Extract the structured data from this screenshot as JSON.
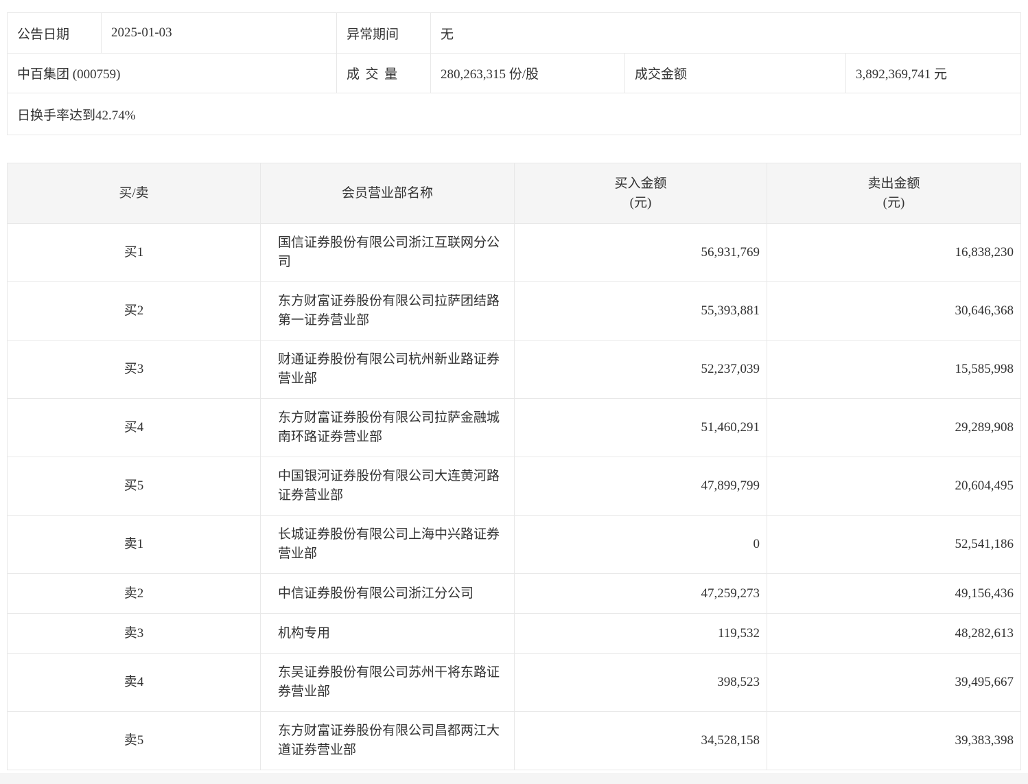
{
  "colors": {
    "header_bg": "#f5f5f5",
    "border": "#e8e8e8",
    "text": "#333333"
  },
  "info": {
    "announce_date_label": "公告日期",
    "announce_date": "2025-01-03",
    "abnormal_period_label": "异常期间",
    "abnormal_period": "无",
    "stock_name": "中百集团 (000759)",
    "volume_label": "成交量",
    "volume_value": "280,263,315 份/股",
    "amount_label": "成交金额",
    "amount_value": "3,892,369,741 元",
    "turnover_note": "日换手率达到42.74%"
  },
  "table": {
    "headers": {
      "side": "买/卖",
      "branch": "会员营业部名称",
      "buy_amount": "买入金额",
      "sell_amount": "卖出金额",
      "unit": "(元)"
    },
    "rows": [
      {
        "label": "买1",
        "name": "国信证券股份有限公司浙江互联网分公司",
        "buy": "56,931,769",
        "sell": "16,838,230"
      },
      {
        "label": "买2",
        "name": "东方财富证券股份有限公司拉萨团结路第一证券营业部",
        "buy": "55,393,881",
        "sell": "30,646,368"
      },
      {
        "label": "买3",
        "name": "财通证券股份有限公司杭州新业路证券营业部",
        "buy": "52,237,039",
        "sell": "15,585,998"
      },
      {
        "label": "买4",
        "name": "东方财富证券股份有限公司拉萨金融城南环路证券营业部",
        "buy": "51,460,291",
        "sell": "29,289,908"
      },
      {
        "label": "买5",
        "name": "中国银河证券股份有限公司大连黄河路证券营业部",
        "buy": "47,899,799",
        "sell": "20,604,495"
      },
      {
        "label": "卖1",
        "name": "长城证券股份有限公司上海中兴路证券营业部",
        "buy": "0",
        "sell": "52,541,186"
      },
      {
        "label": "卖2",
        "name": "中信证券股份有限公司浙江分公司",
        "buy": "47,259,273",
        "sell": "49,156,436"
      },
      {
        "label": "卖3",
        "name": "机构专用",
        "buy": "119,532",
        "sell": "48,282,613"
      },
      {
        "label": "卖4",
        "name": "东吴证券股份有限公司苏州干将东路证券营业部",
        "buy": "398,523",
        "sell": "39,495,667"
      },
      {
        "label": "卖5",
        "name": "东方财富证券股份有限公司昌都两江大道证券营业部",
        "buy": "34,528,158",
        "sell": "39,383,398"
      }
    ]
  }
}
